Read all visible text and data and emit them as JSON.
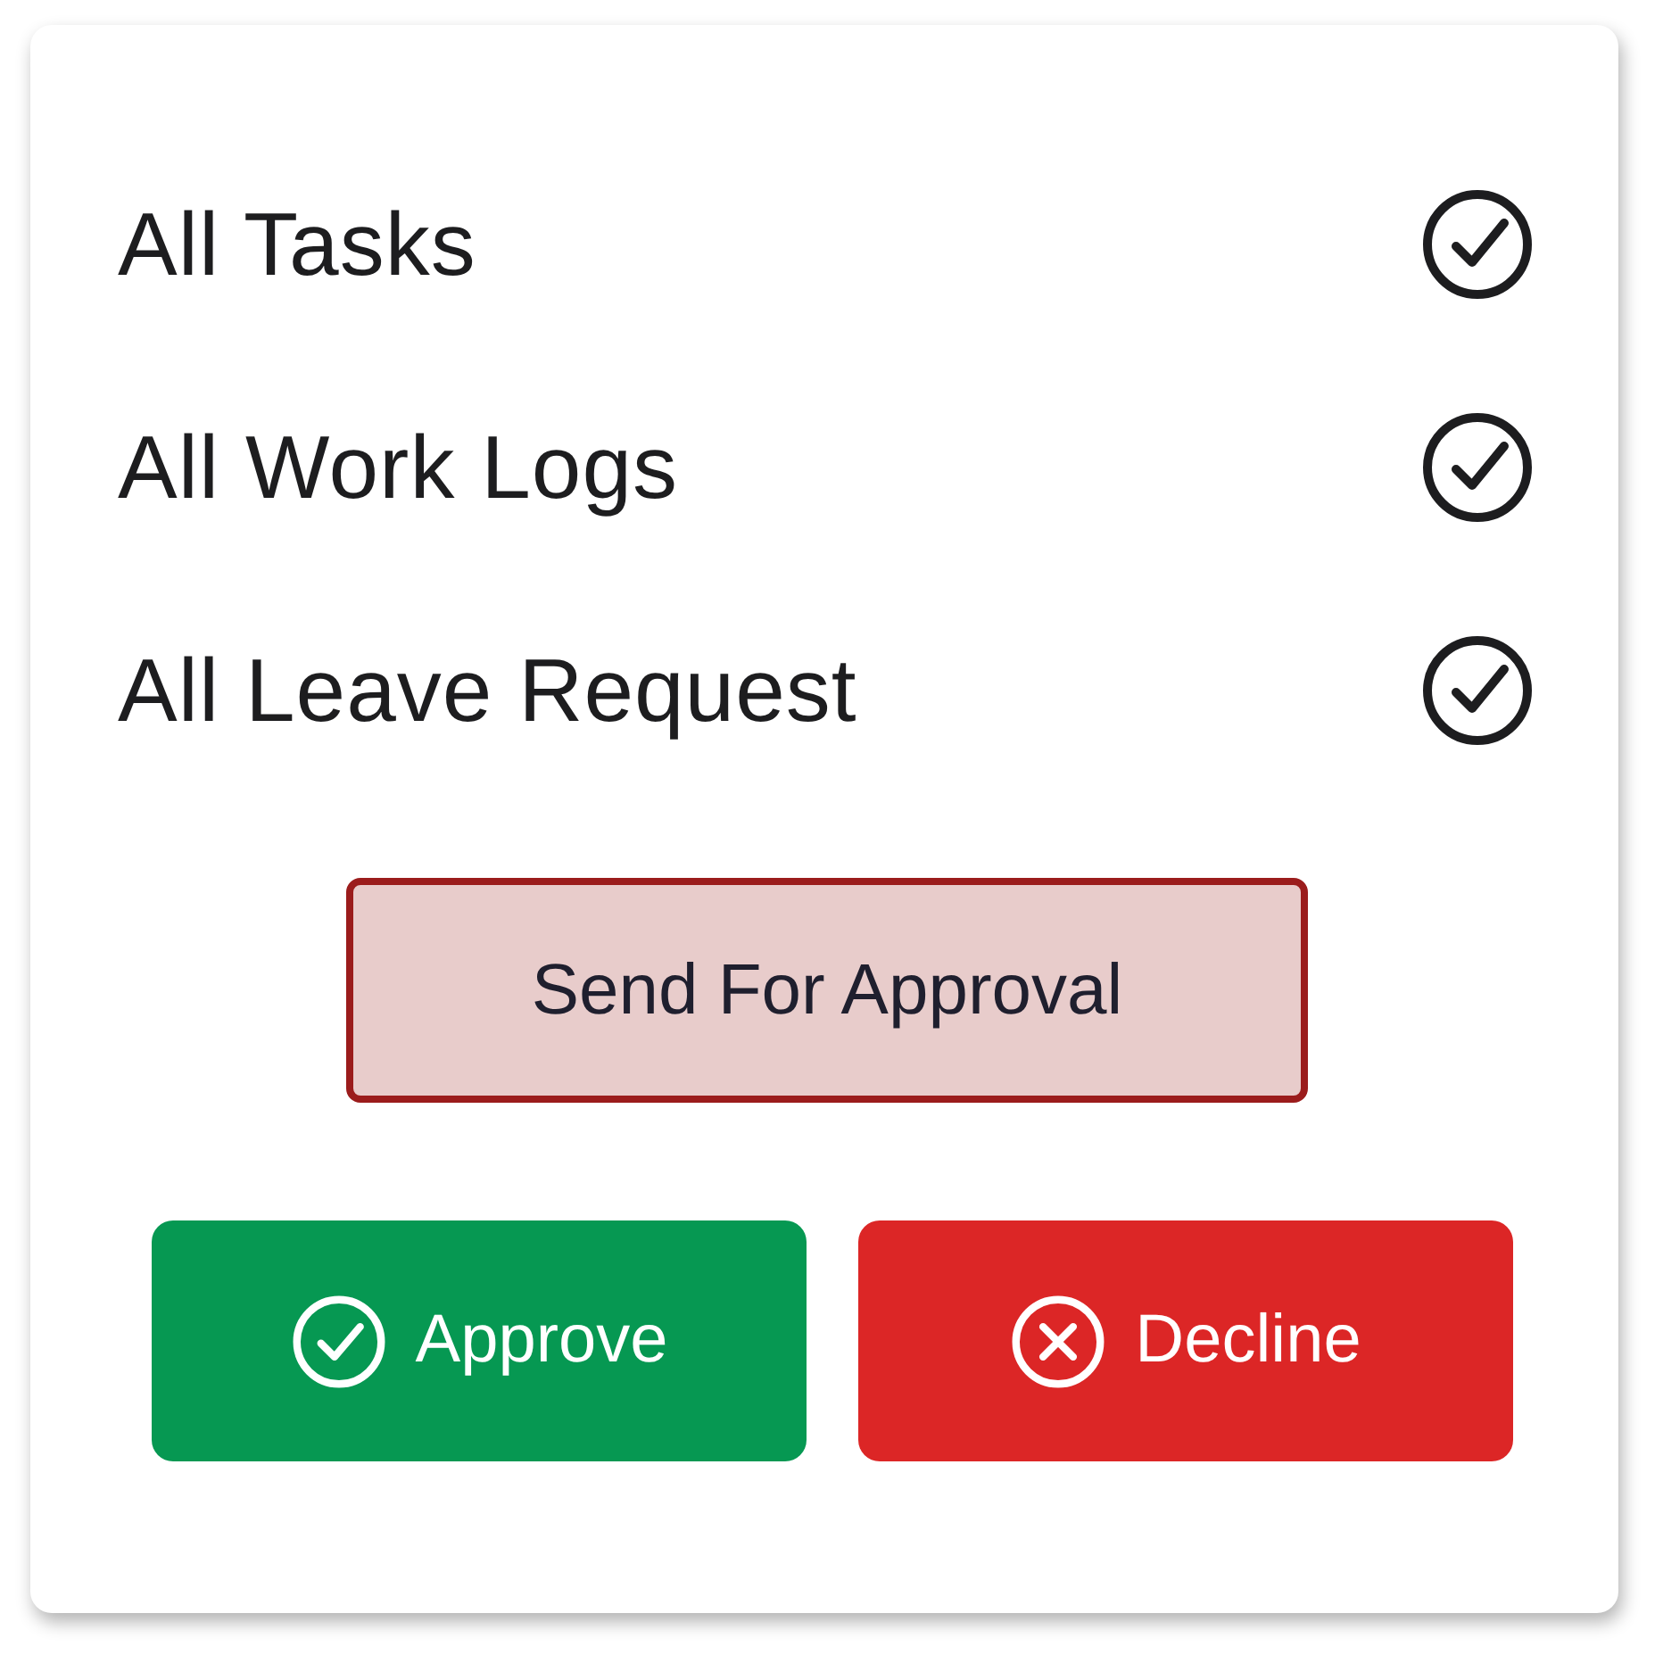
{
  "checklist": [
    {
      "label": "All Tasks",
      "checked": true
    },
    {
      "label": "All Work Logs",
      "checked": true
    },
    {
      "label": "All Leave Request",
      "checked": true
    }
  ],
  "submit_button": {
    "label": "Send For Approval"
  },
  "actions": [
    {
      "kind": "approve",
      "label": "Approve"
    },
    {
      "kind": "decline",
      "label": "Decline"
    }
  ]
}
